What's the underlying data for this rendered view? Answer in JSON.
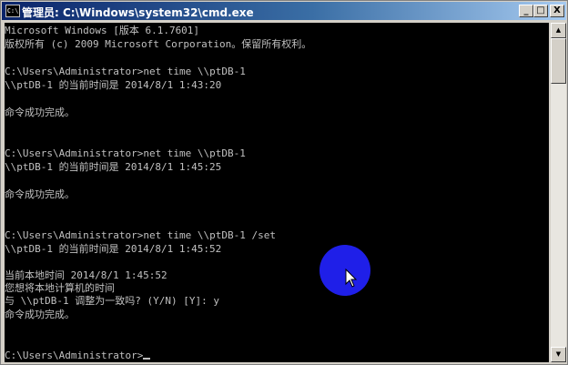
{
  "window": {
    "title": "管理员: C:\\Windows\\system32\\cmd.exe",
    "icon_text": "C:\\",
    "controls": {
      "minimize": "_",
      "maximize": "□",
      "close": "X"
    }
  },
  "console": {
    "lines": [
      "Microsoft Windows [版本 6.1.7601]",
      "版权所有 (c) 2009 Microsoft Corporation。保留所有权利。",
      "",
      "C:\\Users\\Administrator>net time \\\\ptDB-1",
      "\\\\ptDB-1 的当前时间是 2014/8/1 1:43:20",
      "",
      "命令成功完成。",
      "",
      "",
      "C:\\Users\\Administrator>net time \\\\ptDB-1",
      "\\\\ptDB-1 的当前时间是 2014/8/1 1:45:25",
      "",
      "命令成功完成。",
      "",
      "",
      "C:\\Users\\Administrator>net time \\\\ptDB-1 /set",
      "\\\\ptDB-1 的当前时间是 2014/8/1 1:45:52",
      "",
      "当前本地时间 2014/8/1 1:45:52",
      "您想将本地计算机的时间",
      "与 \\\\ptDB-1 调整为一致吗? (Y/N) [Y]: y",
      "命令成功完成。",
      "",
      "",
      "",
      "C:\\Users\\Administrator>"
    ]
  },
  "scrollbar": {
    "up_arrow": "▲",
    "down_arrow": "▼"
  },
  "colors": {
    "console_bg": "#000000",
    "console_text": "#c0c0c0",
    "click_indicator": "#1f1fe8"
  }
}
